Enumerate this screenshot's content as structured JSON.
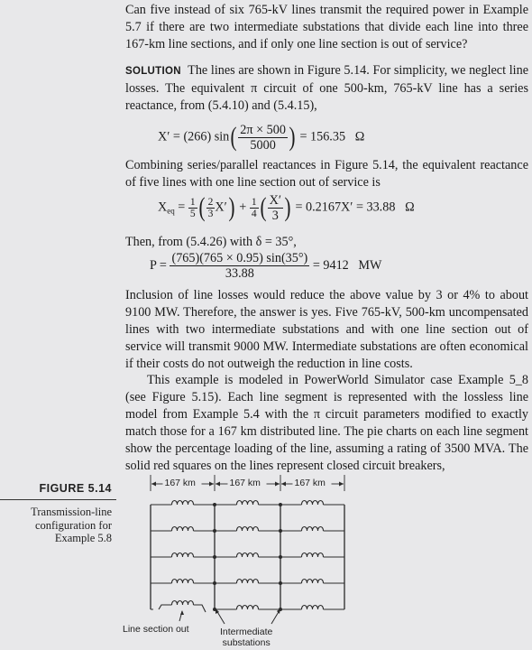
{
  "problem_text": "Can five instead of six 765-kV lines transmit the required power in Example 5.7 if there are two intermediate substations that divide each line into three 167-km line sections, and if only one line section is out of service?",
  "solution": {
    "label": "SOLUTION",
    "intro": "The lines are shown in Figure 5.14. For simplicity, we neglect line losses. The equivalent π circuit of one 500-km, 765-kV line has a series reactance, from (5.4.10) and (5.4.15),",
    "eq1": {
      "lhs": "X′ = (266) sin",
      "num": "2π × 500",
      "den": "5000",
      "rhs": "= 156.35",
      "unit": "Ω"
    },
    "para2": "Combining series/parallel reactances in Figure 5.14, the equivalent reactance of five lines with one line section out of service is",
    "eq2": {
      "lhs_main": "X",
      "lhs_sub": "eq",
      "eqsign": "=",
      "f1_num": "1",
      "f1_den": "5",
      "f2_num": "2",
      "f2_den": "3",
      "term1_var": "X′",
      "plus": "+",
      "f3_num": "1",
      "f3_den": "4",
      "f4_num": "X′",
      "f4_den": "3",
      "rhs": "= 0.2167X′ = 33.88",
      "unit": "Ω"
    },
    "para3": "Then, from (5.4.26) with δ = 35°,",
    "eq3": {
      "lhs": "P =",
      "num": "(765)(765 × 0.95) sin(35°)",
      "den": "33.88",
      "rhs": "= 9412",
      "unit": "MW"
    },
    "para4": "Inclusion of line losses would reduce the above value by 3 or 4% to about 9100 MW. Therefore, the answer is yes. Five 765-kV, 500-km uncompensated lines with two intermediate substations and with one line section out of service will transmit 9000 MW. Intermediate substations are often economical if their costs do not outweigh the reduction in line costs.",
    "para5": "This example is modeled in PowerWorld Simulator case Example 5_8 (see Figure 5.15). Each line segment is represented with the lossless line model from Example 5.4 with the π circuit parameters modified to exactly match those for a 167 km distributed line. The pie charts on each line segment show the percentage loading of the line, assuming a rating of 3500 MVA. The solid red squares on the lines represent closed circuit breakers,"
  },
  "figure": {
    "number": "FIGURE 5.14",
    "caption": "Transmission-line configuration for Example 5.8",
    "segment_labels": [
      "167 km",
      "167 km",
      "167 km"
    ],
    "line_count": 5,
    "sections_per_line": 3,
    "out_of_service": {
      "line": 5,
      "section": 1
    },
    "annotation_out": "Line section out",
    "annotation_substations_1": "Intermediate",
    "annotation_substations_2": "substations"
  }
}
